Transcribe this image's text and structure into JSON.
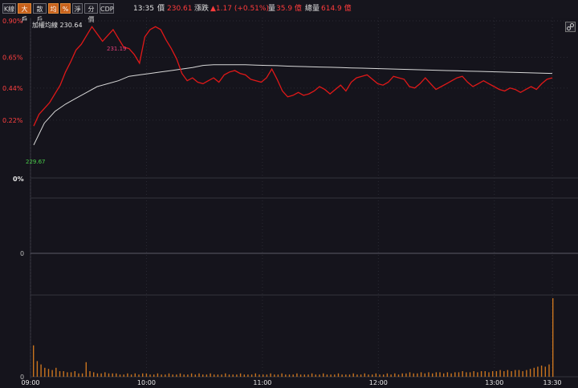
{
  "toolbar": {
    "buttons": [
      {
        "label": "K線",
        "active": false
      },
      {
        "label": "大戶",
        "active": true
      },
      {
        "label": "散戶",
        "active": false
      },
      {
        "label": "均",
        "active": true
      },
      {
        "label": "%",
        "active": true
      },
      {
        "label": "淨",
        "active": false
      },
      {
        "label": "分價",
        "active": false
      },
      {
        "label": "CDP",
        "active": false
      }
    ],
    "time": "13:35",
    "price_label": "價",
    "price_value": "230.61",
    "change_label": "漲跌",
    "change_value": "▲1.17 (+0.51%)",
    "volume_label": "量",
    "volume_value": "35.9 億",
    "total_label": "總量",
    "total_value": "614.9 億"
  },
  "chart_data": {
    "type": "line",
    "legend": "加權均線 230.64",
    "y_ticks": [
      "0.90%",
      "0.65%",
      "0.44%",
      "0.22%"
    ],
    "x_ticks": [
      "09:00",
      "10:00",
      "11:00",
      "12:00",
      "13:00",
      "13:30"
    ],
    "high_label": "231.19",
    "low_label": "229.67",
    "mid_panel_label": "0%",
    "lower_panel_label": "0",
    "volume_zero_label": "0",
    "colors": {
      "price": "#e01818",
      "avg": "#d8d8d8",
      "volume": "#c9741f",
      "high": "#e0407a",
      "low": "#4bd04b"
    },
    "price_pct": [
      0.18,
      0.26,
      0.3,
      0.34,
      0.4,
      0.46,
      0.55,
      0.62,
      0.7,
      0.74,
      0.8,
      0.86,
      0.81,
      0.76,
      0.8,
      0.84,
      0.78,
      0.72,
      0.71,
      0.67,
      0.61,
      0.79,
      0.84,
      0.86,
      0.84,
      0.77,
      0.71,
      0.64,
      0.54,
      0.49,
      0.51,
      0.48,
      0.47,
      0.49,
      0.51,
      0.48,
      0.53,
      0.55,
      0.56,
      0.54,
      0.53,
      0.5,
      0.49,
      0.48,
      0.51,
      0.57,
      0.5,
      0.42,
      0.38,
      0.39,
      0.41,
      0.39,
      0.4,
      0.42,
      0.45,
      0.43,
      0.4,
      0.43,
      0.46,
      0.42,
      0.48,
      0.51,
      0.52,
      0.53,
      0.5,
      0.47,
      0.46,
      0.48,
      0.52,
      0.51,
      0.5,
      0.45,
      0.44,
      0.47,
      0.51,
      0.47,
      0.43,
      0.45,
      0.47,
      0.49,
      0.51,
      0.52,
      0.48,
      0.45,
      0.47,
      0.49,
      0.47,
      0.45,
      0.43,
      0.42,
      0.44,
      0.43,
      0.41,
      0.43,
      0.45,
      0.43,
      0.47,
      0.5,
      0.51
    ],
    "avg_pct": [
      0.05,
      0.2,
      0.28,
      0.33,
      0.37,
      0.41,
      0.45,
      0.47,
      0.49,
      0.52,
      0.53,
      0.54,
      0.55,
      0.56,
      0.57,
      0.58,
      0.595,
      0.6,
      0.6,
      0.6,
      0.6,
      0.597,
      0.595,
      0.593,
      0.59,
      0.588,
      0.586,
      0.584,
      0.582,
      0.58,
      0.578,
      0.576,
      0.574,
      0.572,
      0.57,
      0.568,
      0.566,
      0.564,
      0.562,
      0.56,
      0.558,
      0.556,
      0.554,
      0.552,
      0.55,
      0.548,
      0.546,
      0.544,
      0.542,
      0.54
    ],
    "volume": [
      28,
      14,
      11,
      8,
      7,
      6,
      8,
      5,
      5,
      4,
      4,
      5,
      3,
      3,
      13,
      5,
      4,
      3,
      3,
      4,
      3,
      3,
      3,
      2,
      2,
      3,
      2,
      3,
      2,
      3,
      3,
      2,
      2,
      3,
      2,
      2,
      3,
      2,
      2,
      3,
      2,
      2,
      3,
      2,
      3,
      2,
      2,
      3,
      2,
      2,
      2,
      3,
      2,
      2,
      2,
      3,
      2,
      2,
      2,
      3,
      2,
      2,
      2,
      3,
      2,
      2,
      3,
      2,
      2,
      2,
      3,
      2,
      2,
      2,
      3,
      2,
      2,
      3,
      2,
      2,
      2,
      3,
      2,
      2,
      2,
      3,
      2,
      2,
      3,
      2,
      2,
      3,
      2,
      2,
      3,
      2,
      3,
      2,
      3,
      3,
      4,
      3,
      3,
      4,
      3,
      4,
      3,
      4,
      4,
      3,
      4,
      3,
      4,
      4,
      5,
      4,
      4,
      5,
      4,
      5,
      5,
      4,
      5,
      5,
      6,
      5,
      6,
      5,
      6,
      6,
      5,
      6,
      7,
      8,
      9,
      10,
      9,
      11,
      70
    ]
  }
}
